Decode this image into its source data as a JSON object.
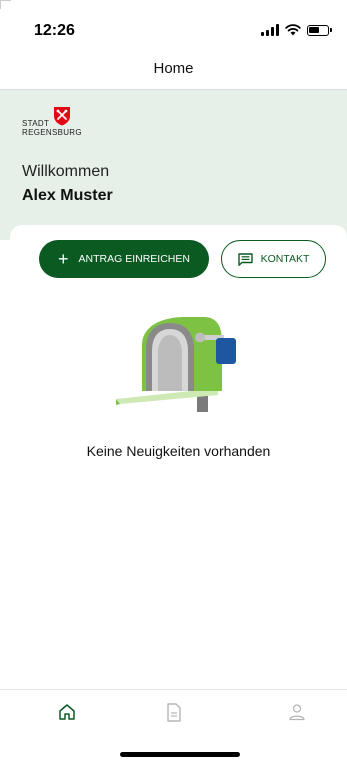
{
  "status_bar": {
    "time": "12:26",
    "signal_icon": "signal-icon",
    "wifi_icon": "wifi-icon",
    "battery_icon": "battery-icon"
  },
  "nav": {
    "title": "Home"
  },
  "header": {
    "logo": {
      "line1": "STADT",
      "line2": "REGENSBURG",
      "crest_icon": "city-crest-icon"
    },
    "welcome_label": "Willkommen",
    "user_name": "Alex Muster"
  },
  "actions": {
    "submit_request": {
      "icon": "plus-icon",
      "label": "ANTRAG EINREICHEN"
    },
    "contact": {
      "icon": "message-icon",
      "label": "KONTAKT"
    }
  },
  "empty_state": {
    "illustration": "mailbox-illustration",
    "message": "Keine Neuigkeiten vorhanden"
  },
  "bottom_nav": {
    "items": [
      {
        "icon": "home-icon",
        "active": true
      },
      {
        "icon": "document-icon",
        "active": false
      },
      {
        "icon": "profile-icon",
        "active": false
      }
    ]
  },
  "colors": {
    "primary": "#0a5a22",
    "header_bg": "#e6efe8",
    "mailbox_green": "#7dc242",
    "flag_blue": "#1e56a0",
    "crest_red": "#e30613"
  }
}
